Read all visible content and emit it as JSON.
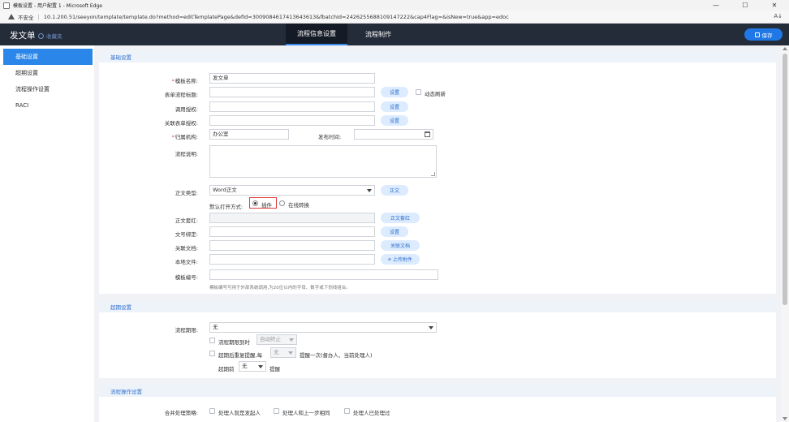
{
  "window": {
    "title": "模板设置 - 用户配置 1 - Microsoft Edge",
    "controls": [
      "—",
      "☐",
      "✕"
    ]
  },
  "address": {
    "security": "不安全",
    "separator": "|",
    "url": "10.1.200.51/seeyon/template/template.do?method=editTemplatePage&defId=3009084617413643613&fbatchId=2426255688109147222&cap4Flag=&isNew=true&app=edoc",
    "read_icon": "A↓"
  },
  "header": {
    "title": "发文单",
    "favorite": "收藏夹",
    "tabs": [
      "流程信息设置",
      "流程制作"
    ],
    "active_tab": 0,
    "save": "保存",
    "accent": "#1f78e6"
  },
  "sidebar": {
    "items": [
      "基础设置",
      "超期设置",
      "流程操作设置",
      "RACI"
    ],
    "active": 0
  },
  "basic": {
    "heading": "基础设置",
    "template_name": {
      "label": "模板名称:",
      "value": "发文单"
    },
    "flow_title": {
      "label": "表单流程标题:",
      "button": "设置",
      "dynamic_label": "动态刷新"
    },
    "use_auth": {
      "label": "调用授权:",
      "button": "设置"
    },
    "rel_auth": {
      "label": "关联表单授权:",
      "button": "设置"
    },
    "org": {
      "label": "归属机构:",
      "value": "办公室"
    },
    "pub_time": {
      "label": "发布时间:"
    },
    "desc": {
      "label": "流程说明:"
    },
    "body_type": {
      "label": "正文类型:",
      "value": "Word正文",
      "button": "正文"
    },
    "open_mode": {
      "label": "默认打开方式:",
      "opt1": "插件",
      "opt2": "在线转换"
    },
    "body_red": {
      "label": "正文套红:",
      "button": "正文套红"
    },
    "doc_bind": {
      "label": "文号绑定:",
      "button": "设置"
    },
    "rel_doc": {
      "label": "关联文档:",
      "button": "关联文档"
    },
    "local_file": {
      "label": "本地文件:",
      "button": "上传附件"
    },
    "tpl_code": {
      "label": "模板编号:",
      "hint": "模板编号可用于外部系统调用,为20位以内的字母、数字或下划线组合。"
    }
  },
  "overdue": {
    "heading": "超期设置",
    "deadline": {
      "label": "流程期限:",
      "value": "无"
    },
    "auto_stop": {
      "label": "流程期限到时",
      "value": "自动终止"
    },
    "remind": {
      "label": "超期后重复提醒,每",
      "value": "无",
      "suffix": "提醒一次(督办人、当前处理人)"
    },
    "before": {
      "prefix": "超期前",
      "value": "无",
      "suffix": "提醒"
    }
  },
  "flowops": {
    "heading": "流程操作设置",
    "merge": {
      "label": "合并处理策略:",
      "opt1": "处理人就是发起人",
      "opt2": "处理人和上一步相同",
      "opt3": "处理人已处理过"
    }
  }
}
